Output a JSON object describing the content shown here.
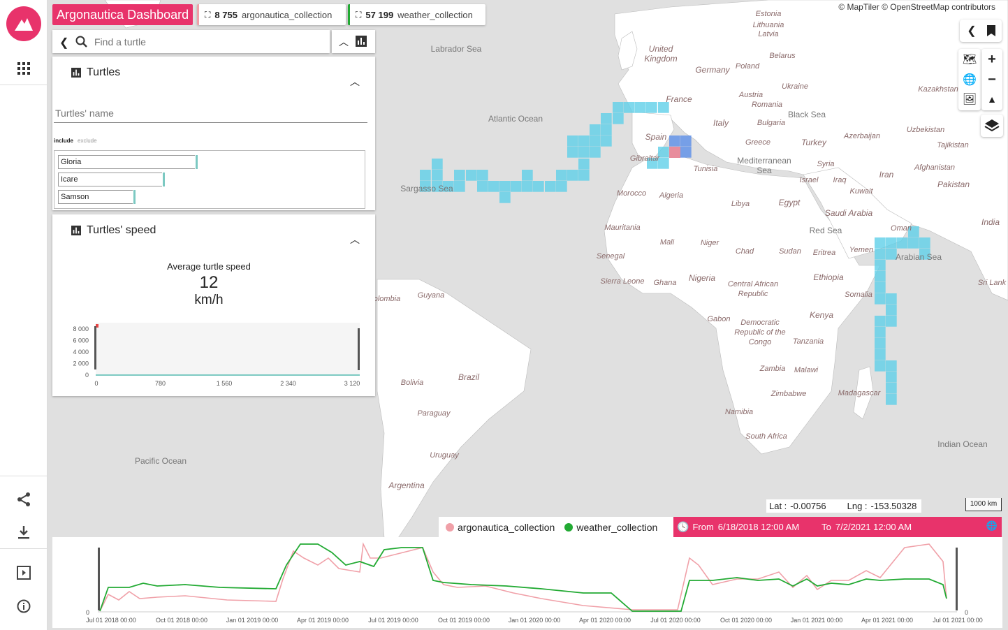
{
  "app": {
    "title": "Argonautica Dashboard"
  },
  "collections": [
    {
      "count": "8 755",
      "name": "argonautica_collection",
      "color": "#f0a0a8"
    },
    {
      "count": "57 199",
      "name": "weather_collection",
      "color": "#22aa33"
    }
  ],
  "attribution": "© MapTiler © OpenStreetMap contributors",
  "search": {
    "placeholder": "Find a turtle"
  },
  "turtles_panel": {
    "title": "Turtles",
    "filter_placeholder": "Turtles' name",
    "include_label": "include",
    "exclude_label": "exclude",
    "items": [
      {
        "label": "Gloria",
        "share": 1.0
      },
      {
        "label": "Icare",
        "share": 0.76
      },
      {
        "label": "Samson",
        "share": 0.55
      }
    ]
  },
  "speed_panel": {
    "title": "Turtles' speed",
    "metric_label": "Average turtle speed",
    "metric_value": "12",
    "metric_unit": "km/h",
    "y_ticks": [
      "8 000",
      "6 000",
      "4 000",
      "2 000",
      "0"
    ],
    "x_ticks": [
      "0",
      "780",
      "1 560",
      "2 340",
      "3 120"
    ]
  },
  "coords": {
    "lat_label": "Lat :",
    "lat": "-0.00756",
    "lng_label": "Lng :",
    "lng": "-153.50328"
  },
  "scale": "1000 km",
  "timeline": {
    "legend": [
      "argonautica_collection",
      "weather_collection"
    ],
    "from_label": "From",
    "from_value": "6/18/2018 12:00 AM",
    "to_label": "To",
    "to_value": "7/2/2021 12:00 AM",
    "y_zero": "0",
    "x_ticks": [
      "Jul 01 2018 00:00",
      "Oct 01 2018 00:00",
      "Jan 01 2019 00:00",
      "Apr 01 2019 00:00",
      "Jul 01 2019 00:00",
      "Oct 01 2019 00:00",
      "Jan 01 2020 00:00",
      "Apr 01 2020 00:00",
      "Jul 01 2020 00:00",
      "Oct 01 2020 00:00",
      "Jan 01 2021 00:00",
      "Apr 01 2021 00:00",
      "Jul 01 2021 00:00"
    ]
  },
  "map_labels": [
    "Labrador Sea",
    "United Kingdom",
    "Germany",
    "Poland",
    "Belarus",
    "Ukraine",
    "France",
    "Spain",
    "Italy",
    "Romania",
    "Bulgaria",
    "Greece",
    "Turkey",
    "Black Sea",
    "Kazakhstan",
    "Uzbekistan",
    "Azerbaijan",
    "Tajikistan",
    "Afghanistan",
    "Syria",
    "Iraq",
    "Iran",
    "Israel",
    "Kuwait",
    "Pakistan",
    "India",
    "Mediterranean Sea",
    "Atlantic Ocean",
    "Sargasso Sea",
    "Gibraltar",
    "Tunisia",
    "Morocco",
    "Algeria",
    "Libya",
    "Egypt",
    "Saudi Arabia",
    "Red Sea",
    "Oman",
    "Yemen",
    "Arabian Sea",
    "Sri Lank",
    "Mauritania",
    "Mali",
    "Niger",
    "Chad",
    "Sudan",
    "Eritrea",
    "Ethiopia",
    "Senegal",
    "Sierra Leone",
    "Ghana",
    "Nigeria",
    "Central African Republic",
    "Somalia",
    "Gabon",
    "Democratic Republic of the Congo",
    "Kenya",
    "Tanzania",
    "Malawi",
    "Zambia",
    "Zimbabwe",
    "Madagascar",
    "Namibia",
    "South Africa",
    "Indian Ocean",
    "Guyana",
    "Brazil",
    "Bolivia",
    "Paraguay",
    "Uruguay",
    "Argentina",
    "Pacific Ocean",
    "Latvia",
    "Lithuania",
    "Austria",
    "Estonia",
    "Colombia"
  ]
}
